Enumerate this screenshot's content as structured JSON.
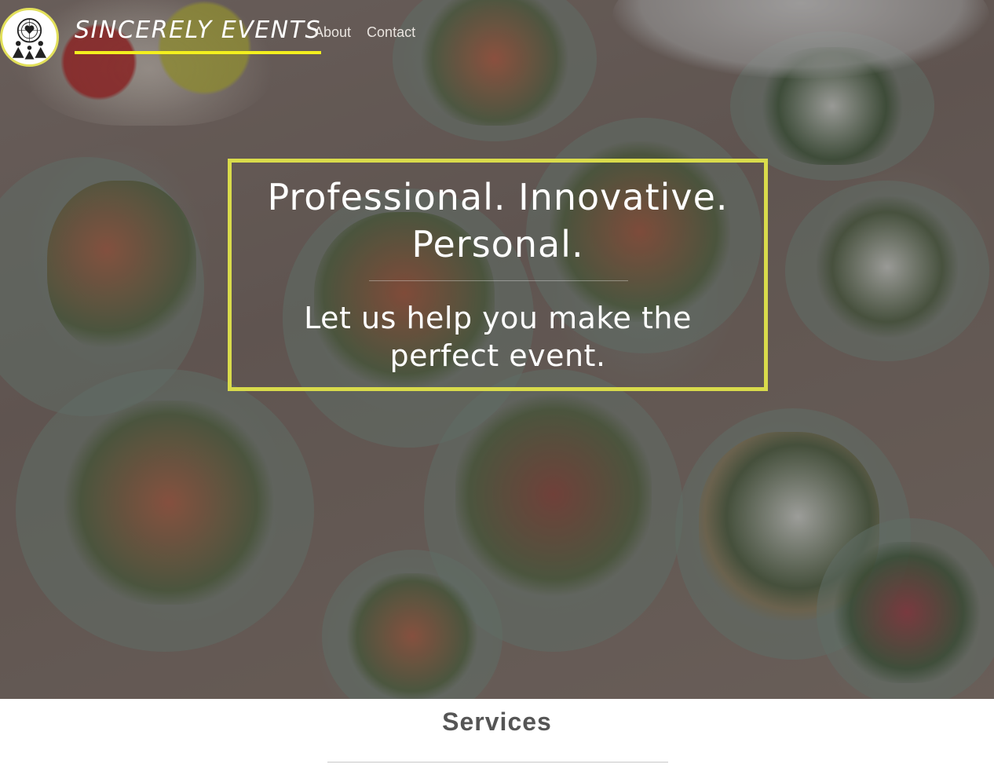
{
  "site": {
    "brand_name": "Sincerely Events",
    "logo_alt": "dreamcatcher-family-logo"
  },
  "nav": {
    "items": [
      {
        "label": "About"
      },
      {
        "label": "Contact"
      }
    ]
  },
  "hero": {
    "headline_line1": "Professional. Innovative.",
    "headline_line2": "Personal.",
    "subheadline": "Let us help you make the perfect event."
  },
  "services": {
    "title": "Services"
  },
  "colors": {
    "accent_yellow": "#f3ef1e",
    "box_border": "#d9db4b",
    "heading_gray": "#555555"
  }
}
